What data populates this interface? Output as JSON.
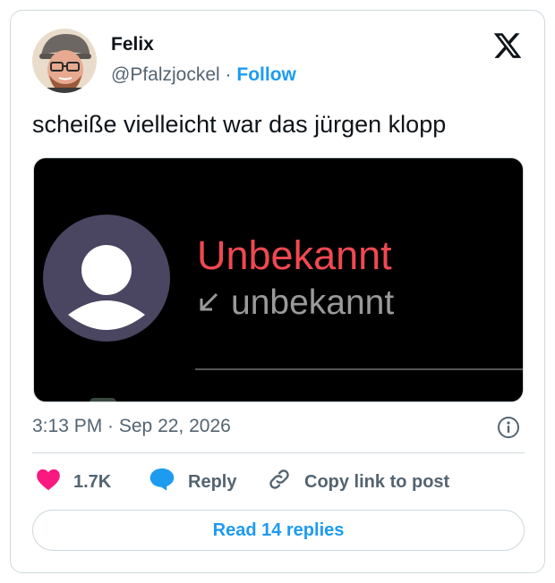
{
  "author": {
    "name": "Felix",
    "handle": "@Pfalzjockel",
    "separator": "·",
    "follow_label": "Follow"
  },
  "tweet": {
    "text": "scheiße vielleicht war das jürgen klopp"
  },
  "media": {
    "caller_title": "Unbekannt",
    "caller_sub": "unbekannt",
    "title_color": "#f04852"
  },
  "meta": {
    "timestamp": "3:13 PM · Sep 22, 2026"
  },
  "actions": {
    "likes_count": "1.7K",
    "reply_label": "Reply",
    "copy_label": "Copy link to post"
  },
  "footer": {
    "read_replies_label": "Read 14 replies"
  },
  "colors": {
    "accent": "#1d9bf0",
    "like": "#f91880",
    "text_secondary": "#536471"
  }
}
